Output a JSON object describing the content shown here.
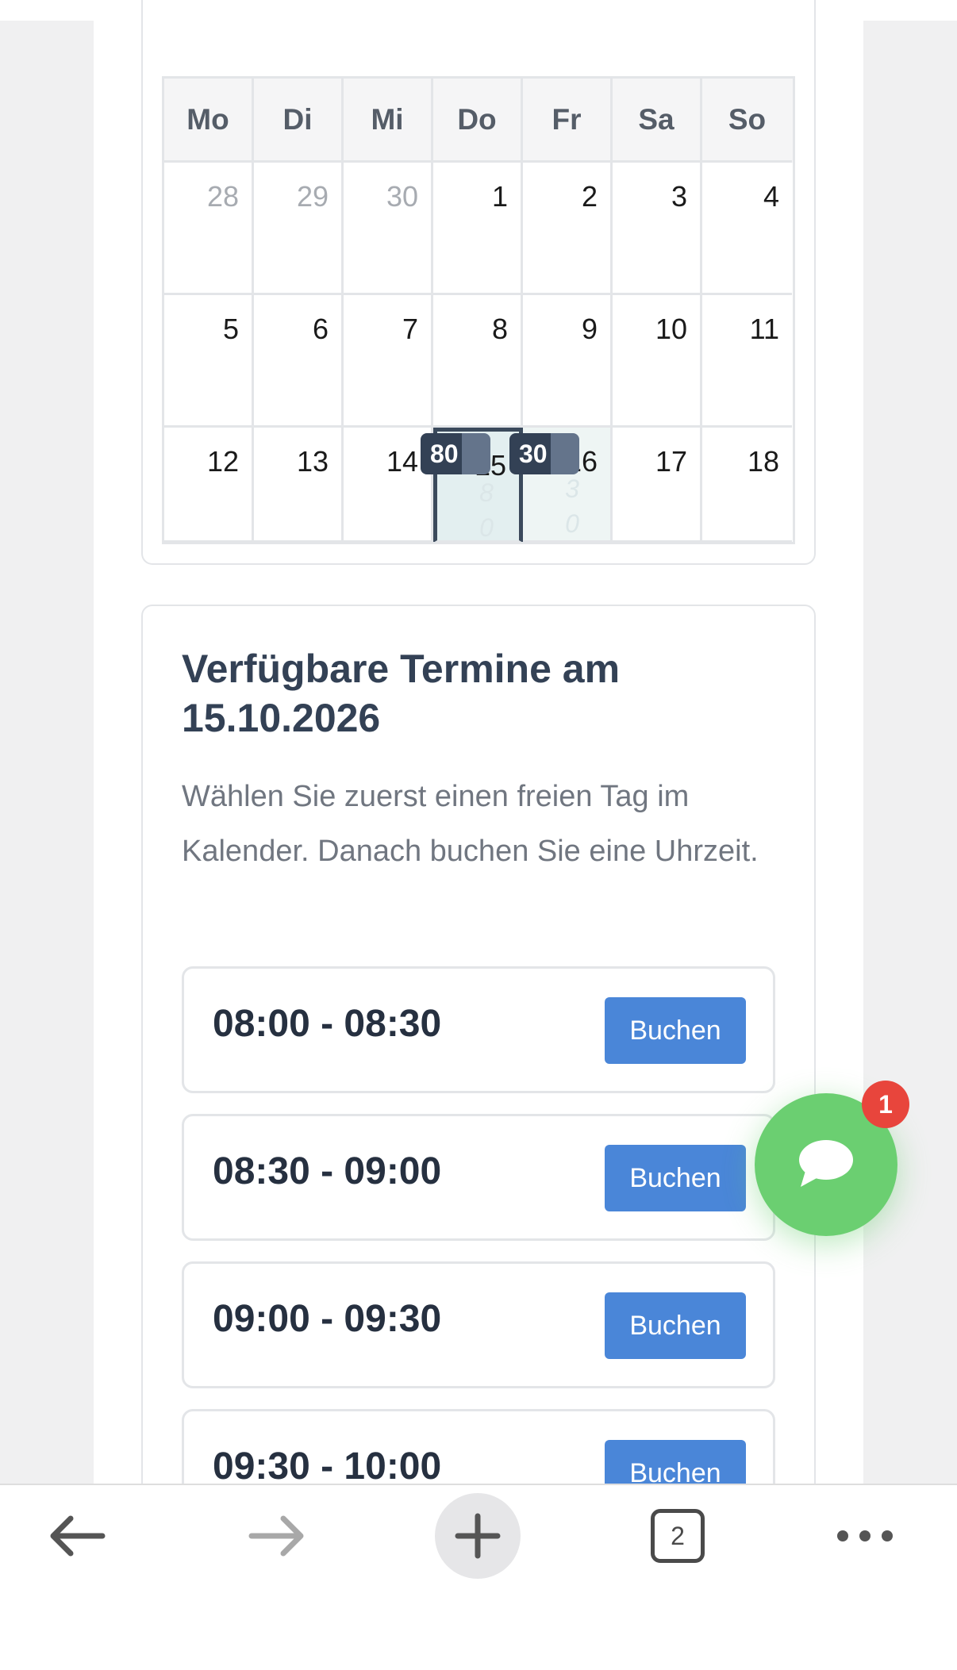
{
  "calendar": {
    "weekdays": [
      "Mo",
      "Di",
      "Mi",
      "Do",
      "Fr",
      "Sa",
      "So"
    ],
    "weeks": [
      [
        "28",
        "29",
        "30",
        "1",
        "2",
        "3",
        "4"
      ],
      [
        "5",
        "6",
        "7",
        "8",
        "9",
        "10",
        "11"
      ],
      [
        "12",
        "13",
        "14",
        "15",
        "16",
        "17",
        "18"
      ]
    ],
    "badges": {
      "day15": "80",
      "day16": "30"
    },
    "ghost": {
      "day15_a": "8",
      "day15_b": "0",
      "day16_a": "3",
      "day16_b": "0"
    }
  },
  "times": {
    "title": "Verfügbare Termine am 15.10.2026",
    "description": "Wählen Sie zuerst einen freien Tag im Kalender. Danach buchen Sie eine Uhrzeit.",
    "slots": [
      {
        "time": "08:00 - 08:30",
        "button": "Buchen"
      },
      {
        "time": "08:30 - 09:00",
        "button": "Buchen"
      },
      {
        "time": "09:00 - 09:30",
        "button": "Buchen"
      },
      {
        "time": "09:30 - 10:00",
        "button": "Buchen"
      }
    ]
  },
  "chat": {
    "unread": "1"
  },
  "browser": {
    "tab_count": "2"
  },
  "colors": {
    "accent": "#4a86d8",
    "chat": "#6bcf71",
    "badge": "#e8453c"
  }
}
